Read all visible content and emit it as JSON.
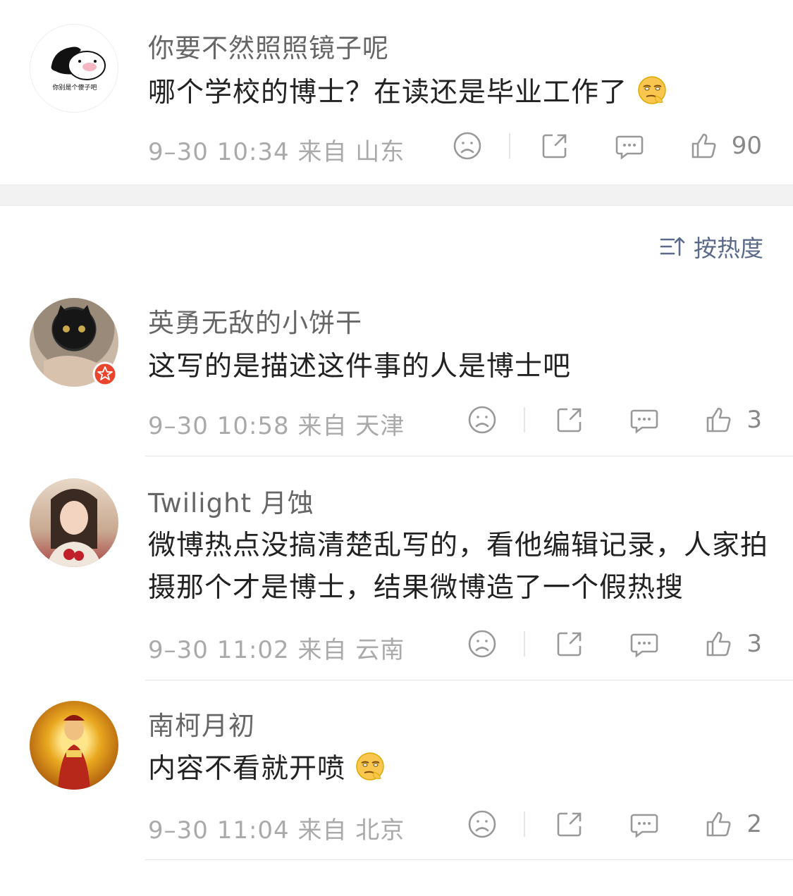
{
  "top_comment": {
    "name": "你要不然照照镜子呢",
    "avatar_caption": "你别是个傻子吧",
    "text": "哪个学校的博士？在读还是毕业工作了",
    "emoji": "smirk-emoji",
    "meta": "9–30 10:34  来自 山东",
    "likes": "90"
  },
  "sort": {
    "label": "按热度",
    "icon": "sort-icon"
  },
  "comments": [
    {
      "name": "英勇无敌的小饼干",
      "text": "这写的是描述这件事的人是博士吧",
      "meta": "9–30 10:58  来自 天津",
      "likes": "3",
      "badge": true
    },
    {
      "name": "Twilight 月蚀",
      "text": "微博热点没搞清楚乱写的，看他编辑记录，人家拍摄那个才是博士，结果微博造了一个假热搜",
      "meta": "9–30 11:02  来自 云南",
      "likes": "3"
    },
    {
      "name": "南柯月初",
      "text": "内容不看就开喷",
      "emoji": "smirk-emoji",
      "meta": "9–30 11:04  来自 北京",
      "likes": "2"
    }
  ],
  "colors": {
    "link": "#5b6a8a",
    "meta": "#aaaaaa",
    "separator": "#f2f2f2",
    "badge": "#e8452c"
  }
}
